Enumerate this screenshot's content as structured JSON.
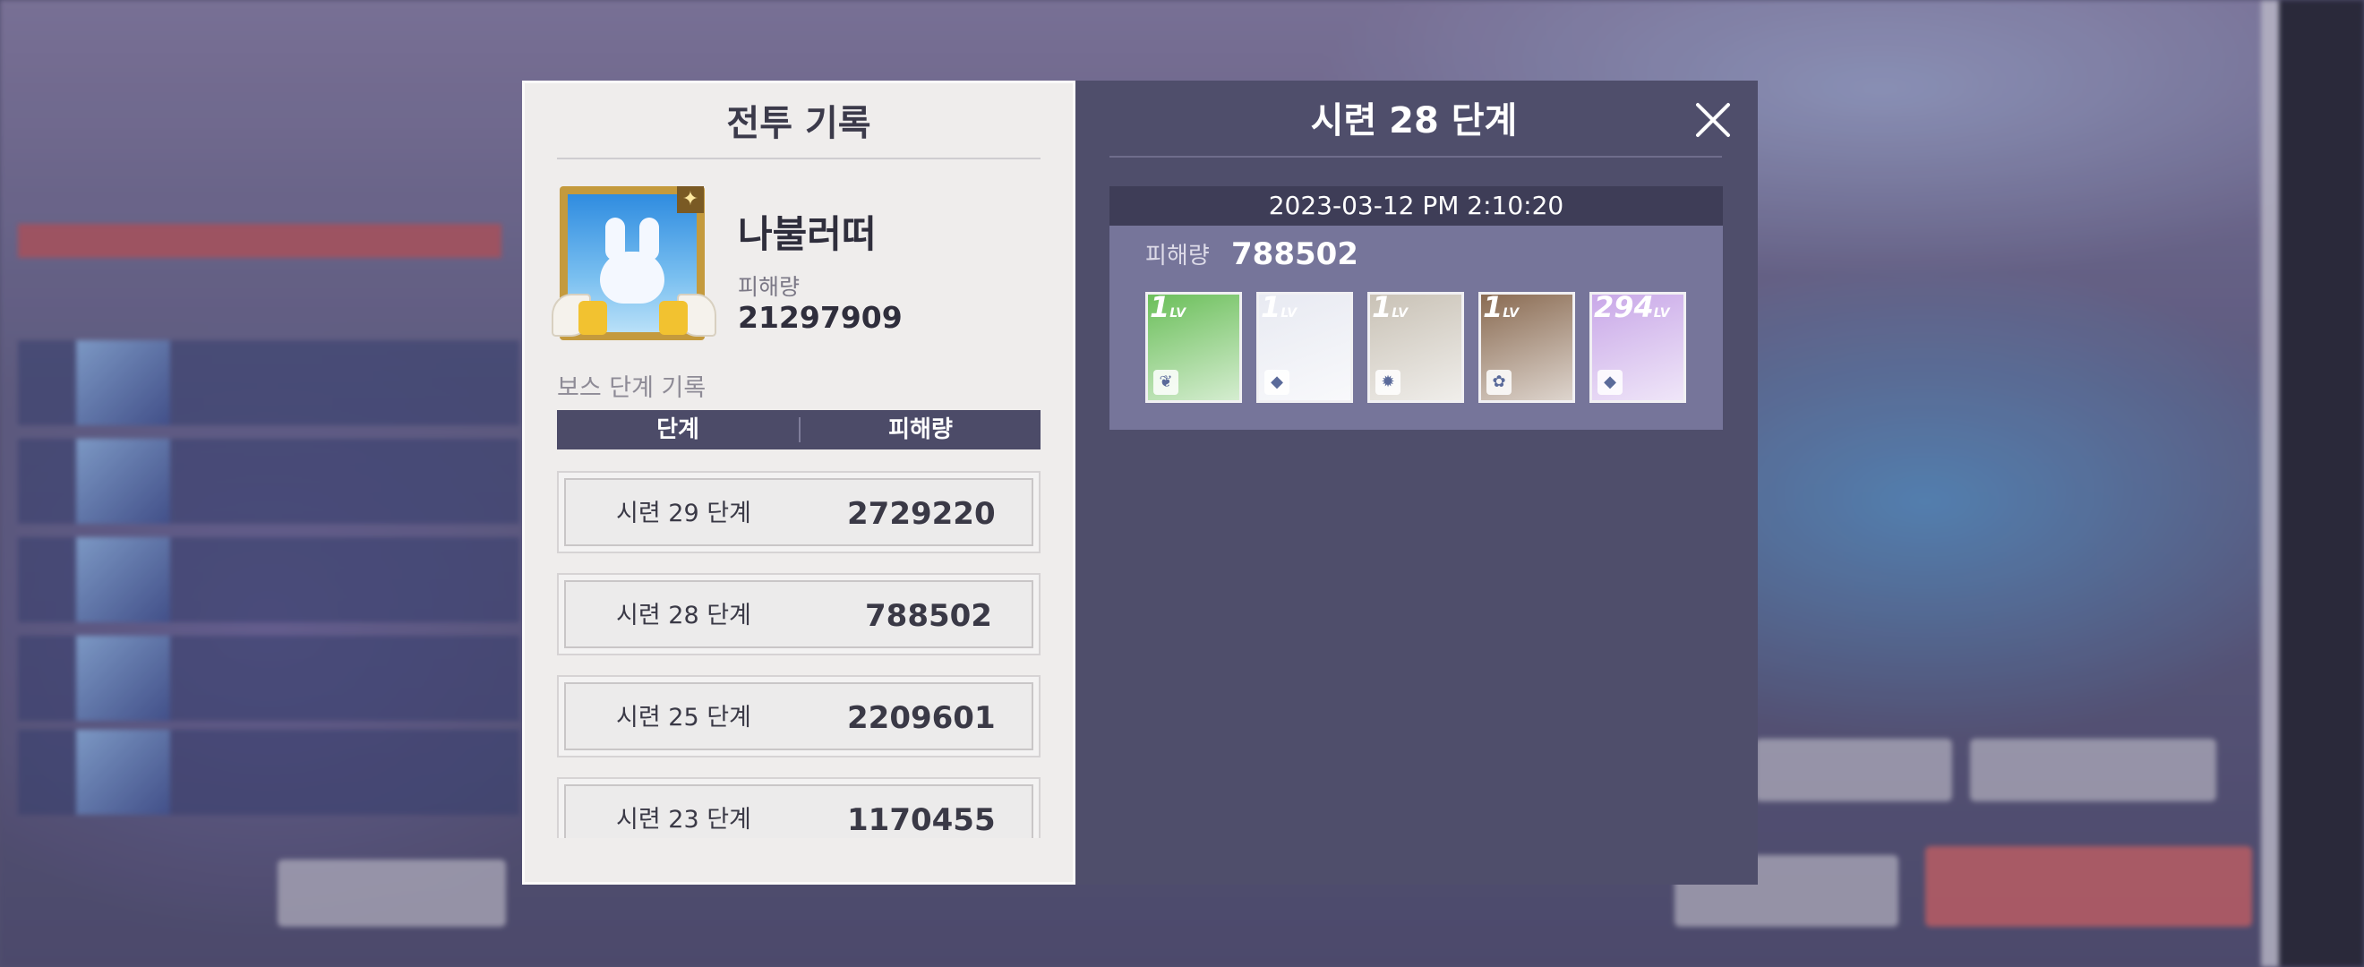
{
  "left_panel": {
    "title": "전투 기록",
    "player_name": "나불러떠",
    "damage_label": "피해량",
    "damage_value": "21297909",
    "boss_record_label": "보스 단계 기록",
    "table_headers": [
      "단계",
      "피해량"
    ],
    "records": [
      {
        "stage": "시련 29 단계",
        "damage": "2729220"
      },
      {
        "stage": "시련 28 단계",
        "damage": "788502"
      },
      {
        "stage": "시련 25 단계",
        "damage": "2209601"
      },
      {
        "stage": "시련 23 단계",
        "damage": "1170455"
      }
    ]
  },
  "right_panel": {
    "title": "시련 28 단계",
    "record": {
      "datetime": "2023-03-12 PM 2:10:20",
      "damage_label": "피해량",
      "damage_value": "788502",
      "party": [
        {
          "level": "1",
          "element_icon": "leaf-icon",
          "color": "#6bbf5a"
        },
        {
          "level": "1",
          "element_icon": "diamond-icon",
          "color": "#e8eaf2"
        },
        {
          "level": "1",
          "element_icon": "flame-icon",
          "color": "#c9c2b6"
        },
        {
          "level": "1",
          "element_icon": "paw-icon",
          "color": "#8a6b52"
        },
        {
          "level": "294",
          "element_icon": "diamond-icon",
          "color": "#c9a8e8"
        }
      ]
    }
  },
  "colors": {
    "left_bg": "#efedec",
    "right_bg": "#4f4e6b",
    "table_header_bg": "#4c4b68",
    "record_date_bg": "#3e3d57",
    "record_body_bg": "#76759a"
  }
}
